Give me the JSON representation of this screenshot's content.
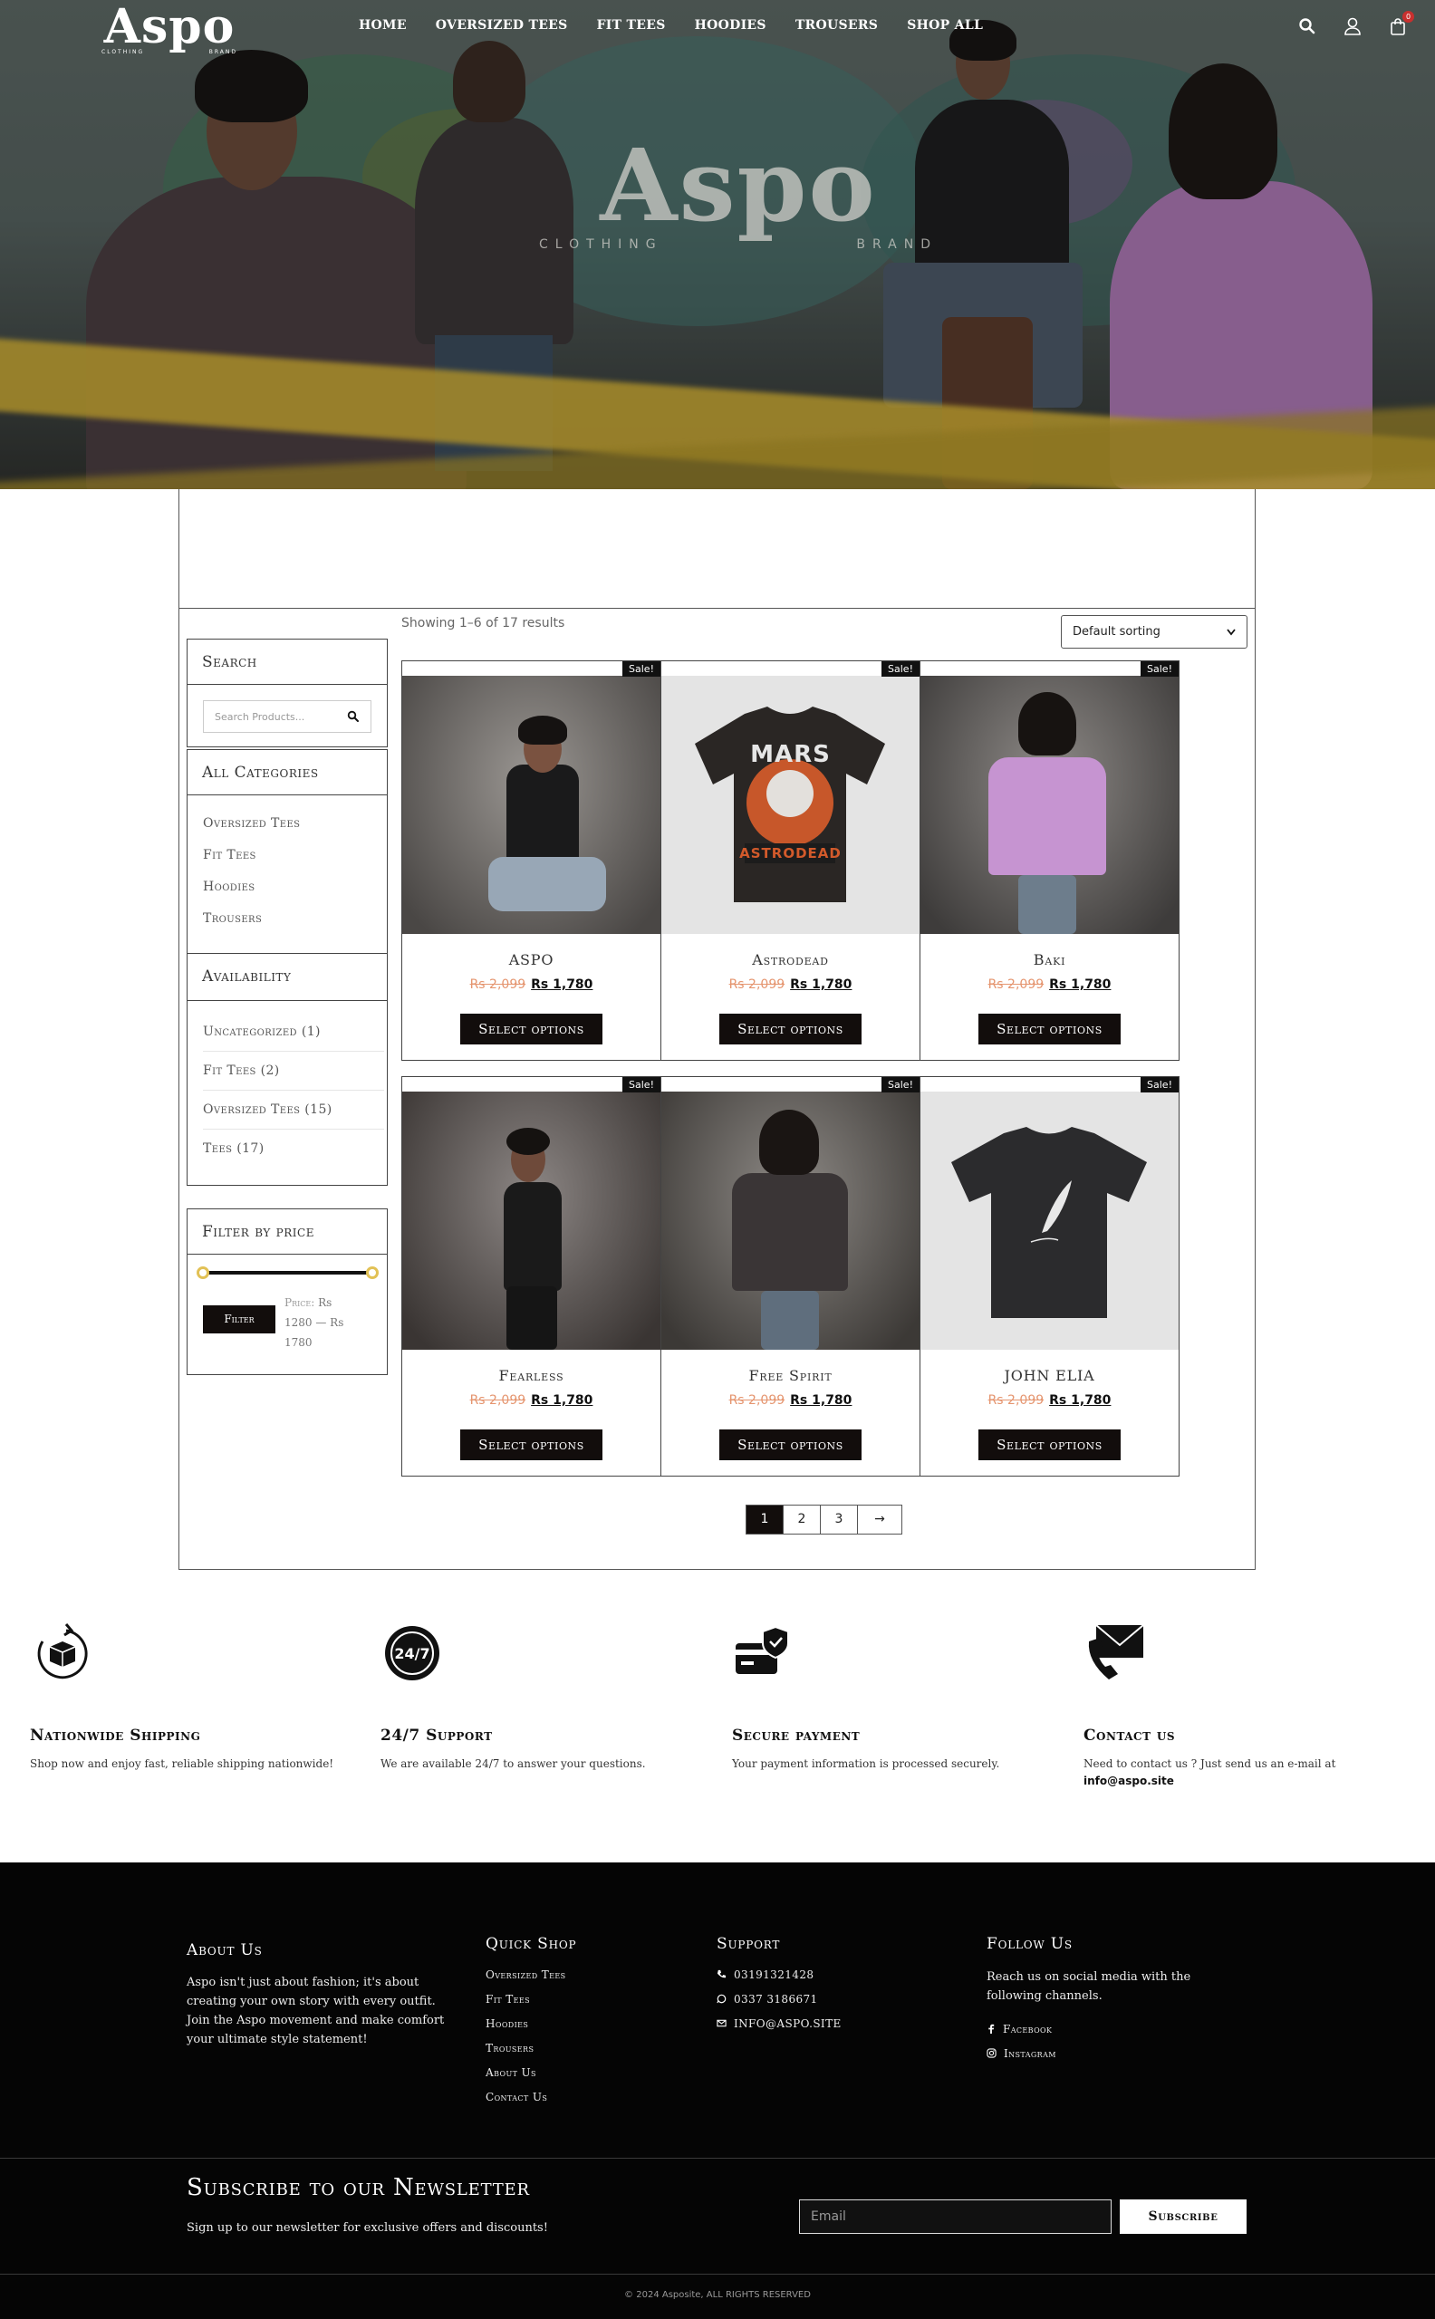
{
  "header": {
    "logo_name": "Aspo",
    "logo_tag_left": "CLOTHING",
    "logo_tag_right": "BRAND",
    "nav": [
      "HOME",
      "OVERSIZED TEES",
      "FIT TEES",
      "HOODIES",
      "TROUSERS",
      "SHOP ALL"
    ],
    "cart_count": "0",
    "icons": [
      "search-icon",
      "user-icon",
      "shopping-bag-icon"
    ]
  },
  "hero": {
    "brand_name": "Aspo",
    "tag_left": "CLOTHING",
    "tag_right": "BRAND"
  },
  "shop": {
    "results_text": "Showing 1–6 of 17 results",
    "sort_value": "Default sorting"
  },
  "sidebar": {
    "search_title": "Search",
    "search_placeholder": "Search Products...",
    "categories_title": "All Categories",
    "categories": [
      "Oversized Tees",
      "Fit Tees",
      "Hoodies",
      "Trousers"
    ],
    "availability_title": "Availability",
    "availability": [
      "Uncategorized (1)",
      "Fit Tees (2)",
      "Oversized Tees (15)",
      "Tees (17)"
    ],
    "price_title": "Filter by price",
    "filter_button": "Filter",
    "price_label": "Price:",
    "price_range": "Rs 1280 — Rs 1780"
  },
  "products": [
    {
      "name": "ASPO",
      "sale": "Sale!",
      "old_price": "Rs 2,099",
      "new_price": "Rs 1,780",
      "button": "Select options"
    },
    {
      "name": "Astrodead",
      "sale": "Sale!",
      "old_price": "Rs 2,099",
      "new_price": "Rs 1,780",
      "button": "Select options",
      "print_top": "MARS",
      "print_bottom": "ASTRODEAD"
    },
    {
      "name": "Baki",
      "sale": "Sale!",
      "old_price": "Rs 2,099",
      "new_price": "Rs 1,780",
      "button": "Select options"
    },
    {
      "name": "Fearless",
      "sale": "Sale!",
      "old_price": "Rs 2,099",
      "new_price": "Rs 1,780",
      "button": "Select options"
    },
    {
      "name": "Free Spirit",
      "sale": "Sale!",
      "old_price": "Rs 2,099",
      "new_price": "Rs 1,780",
      "button": "Select options"
    },
    {
      "name": "JOHN ELIA",
      "sale": "Sale!",
      "old_price": "Rs 2,099",
      "new_price": "Rs 1,780",
      "button": "Select options"
    }
  ],
  "pagination": [
    "1",
    "2",
    "3",
    "→"
  ],
  "features": [
    {
      "title": "Nationwide Shipping",
      "text": "Shop now and enjoy fast, reliable shipping nationwide!",
      "icon": "shipping-box-icon"
    },
    {
      "title": "24/7 Support",
      "text": "We are available 24/7 to answer your questions.",
      "icon": "support-24-7-icon"
    },
    {
      "title": "Secure payment",
      "text": "Your payment information is processed securely.",
      "icon": "secure-card-icon"
    },
    {
      "title": "Contact us",
      "text": "Need to contact us ? Just send us an e-mail at",
      "email": "info@aspo.site",
      "icon": "phone-mail-icon"
    }
  ],
  "footer": {
    "about_title": "About Us",
    "about_text": "Aspo isn't just about fashion; it's about creating your own story with every outfit. Join the Aspo movement and make comfort your ultimate style statement!",
    "quick_title": "Quick Shop",
    "quick_links": [
      "Oversized Tees",
      "Fit Tees",
      "Hoodies",
      "Trousers",
      "About Us",
      "Contact Us"
    ],
    "support_title": "Support",
    "support_phone": "03191321428",
    "support_whatsapp": "0337 3186671",
    "support_email": "INFO@ASPO.SITE",
    "follow_title": "Follow Us",
    "follow_text": "Reach us on social media with the following channels.",
    "social": [
      "Facebook",
      "Instagram"
    ],
    "newsletter_title": "Subscribe to our Newsletter",
    "newsletter_sub": "Sign up to our newsletter for exclusive offers and discounts!",
    "email_placeholder": "Email",
    "subscribe_button": "Subscribe",
    "copyright": "© 2024 Asposite, ALL RIGHTS RESERVED"
  }
}
